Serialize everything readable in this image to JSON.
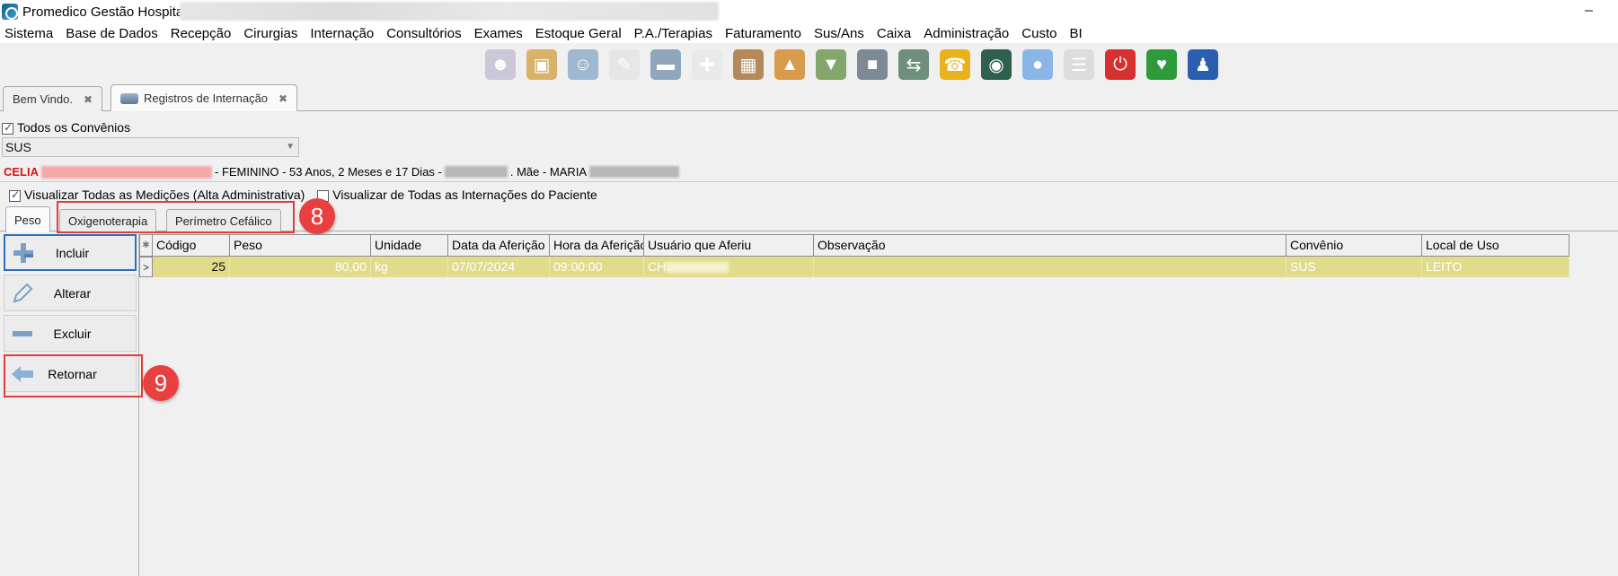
{
  "window": {
    "title": "Promedico Gestão Hospitalar",
    "minimize_glyph": "–"
  },
  "menu": [
    "Sistema",
    "Base de Dados",
    "Recepção",
    "Cirurgias",
    "Internação",
    "Consultórios",
    "Exames",
    "Estoque Geral",
    "P.A./Terapias",
    "Faturamento",
    "Sus/Ans",
    "Caixa",
    "Administração",
    "Custo",
    "BI"
  ],
  "toolbar_icons": [
    {
      "name": "users-refresh-icon",
      "color": "#c9c9d9",
      "glyph": "☻"
    },
    {
      "name": "patient-card-icon",
      "color": "#d8b26b",
      "glyph": "▣"
    },
    {
      "name": "doctor-icon",
      "color": "#9fb7d0",
      "glyph": "☺"
    },
    {
      "name": "prescription-icon",
      "color": "#e6e6e6",
      "glyph": "✎"
    },
    {
      "name": "hospital-bed-icon",
      "color": "#8fa6bd",
      "glyph": "▬"
    },
    {
      "name": "ambulance-icon",
      "color": "#e9e9e9",
      "glyph": "✚"
    },
    {
      "name": "boxes-icon",
      "color": "#b48a5a",
      "glyph": "▦"
    },
    {
      "name": "stock-up-icon",
      "color": "#d89a4c",
      "glyph": "▲"
    },
    {
      "name": "money-down-icon",
      "color": "#84a56b",
      "glyph": "▼"
    },
    {
      "name": "safe-icon",
      "color": "#7d8a96",
      "glyph": "■"
    },
    {
      "name": "cash-exchange-icon",
      "color": "#6e8f7a",
      "glyph": "⇆"
    },
    {
      "name": "phone-book-icon",
      "color": "#e9b21c",
      "glyph": "☎"
    },
    {
      "name": "book-icon",
      "color": "#2f5f4f",
      "glyph": "◉"
    },
    {
      "name": "chat-icon",
      "color": "#8ab6e6",
      "glyph": "●"
    },
    {
      "name": "report-icon",
      "color": "#dcdcdc",
      "glyph": "☰"
    },
    {
      "name": "power-icon",
      "color": "#d63030",
      "glyph": "⏻"
    },
    {
      "name": "heartbeat-book-icon",
      "color": "#2e9a3a",
      "glyph": "♥"
    },
    {
      "name": "contact-book-icon",
      "color": "#2a5fb0",
      "glyph": "♟"
    }
  ],
  "doc_tabs": [
    {
      "label": "Bem Vindo.",
      "close": "✖"
    },
    {
      "label": "Registros de Internação",
      "close": "✖"
    }
  ],
  "filter": {
    "all_insurances_label": "Todos os Convênios",
    "insurance_value": "SUS",
    "combo_arrow": "▼"
  },
  "patient": {
    "name": "CELIA",
    "info": "- FEMININO - 53 Anos, 2 Meses e 17 Dias -",
    "mother_label": ". Mãe - MARIA"
  },
  "options": {
    "view_all_measurements": "Visualizar Todas as Medições (Alta Administrativa)",
    "view_all_admissions": "Visualizar de Todas as Internações do Paciente"
  },
  "inner_tabs": [
    "Peso",
    "Oxigenoterapia",
    "Perímetro Cefálico"
  ],
  "callouts": [
    "8",
    "9"
  ],
  "actions": {
    "include": "Incluir",
    "alter": "Alterar",
    "delete": "Excluir",
    "back": "Retornar"
  },
  "grid": {
    "columns": [
      "Código",
      "Peso",
      "Unidade",
      "Data da Aferição",
      "Hora da Aferição",
      "Usuário que Aferiu",
      "Observação",
      "Convênio",
      "Local de Uso"
    ],
    "row_indicator": ">",
    "header_corner": "✱",
    "rows": [
      {
        "codigo": "25",
        "peso": "80,00",
        "unidade": "kg",
        "data": "07/07/2024",
        "hora": "09:00:00",
        "usuario": "CH",
        "observacao": "",
        "convenio": "SUS",
        "local": "LEITO"
      }
    ]
  }
}
